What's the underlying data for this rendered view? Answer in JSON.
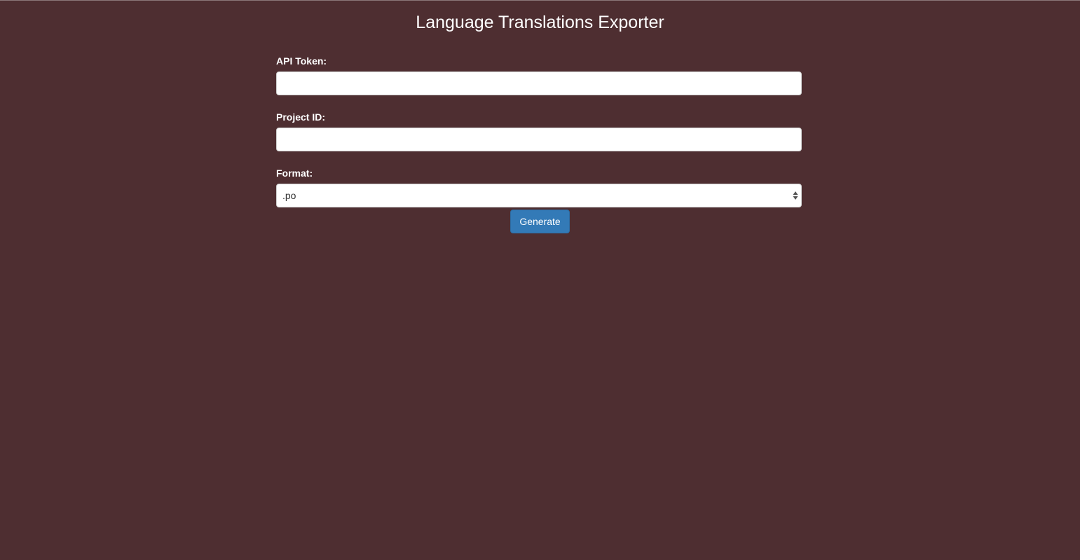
{
  "page": {
    "title": "Language Translations Exporter",
    "background_color": "#4e2e31"
  },
  "form": {
    "api_token": {
      "label": "API Token:",
      "value": "",
      "placeholder": ""
    },
    "project_id": {
      "label": "Project ID:",
      "value": "",
      "placeholder": ""
    },
    "format": {
      "label": "Format:",
      "selected": ".po",
      "icon": "select-arrows-icon"
    },
    "generate_button": {
      "label": "Generate",
      "color": "#337ab7"
    }
  }
}
